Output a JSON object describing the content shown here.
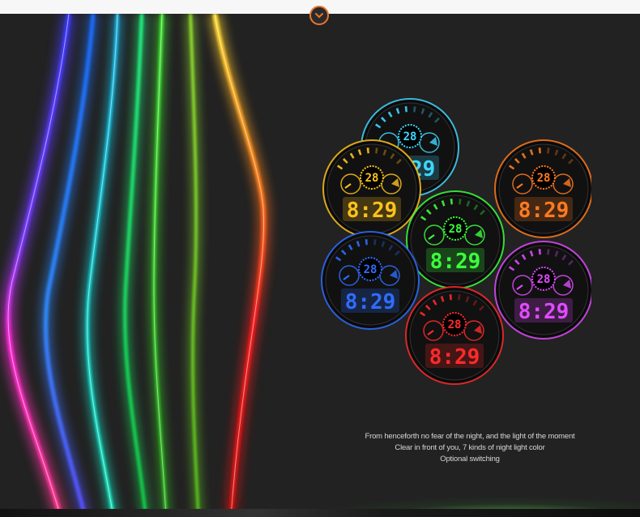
{
  "icons": {
    "toggle": "chevron-down-icon"
  },
  "colors": {
    "accent": "#e8772e",
    "background": "#222222"
  },
  "watch_faces": [
    {
      "color_name": "cyan",
      "color": "#3fd6ff",
      "day": "28",
      "time": "8:29"
    },
    {
      "color_name": "yellow",
      "color": "#ffc21a",
      "day": "28",
      "time": "8:29"
    },
    {
      "color_name": "orange",
      "color": "#ff7a1f",
      "day": "28",
      "time": "8:29"
    },
    {
      "color_name": "green",
      "color": "#3dff3d",
      "day": "28",
      "time": "8:29"
    },
    {
      "color_name": "blue",
      "color": "#2f6dff",
      "day": "28",
      "time": "8:29"
    },
    {
      "color_name": "magenta",
      "color": "#e04bff",
      "day": "28",
      "time": "8:29"
    },
    {
      "color_name": "red",
      "color": "#ff2a2a",
      "day": "28",
      "time": "8:29"
    }
  ],
  "caption": {
    "line1": "From henceforth no fear of the night, and the light of the moment",
    "line2": "Clear in front of you, 7 kinds of night light color",
    "line3": "Optional switching"
  }
}
